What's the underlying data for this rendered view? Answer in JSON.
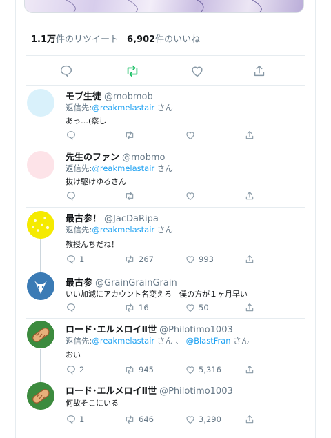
{
  "stats": {
    "retweets_count": "1.1万",
    "retweets_label": "件のリツイート",
    "likes_count": "6,902",
    "likes_label": "件のいいね"
  },
  "colors": {
    "accent": "#1da1f2",
    "retweet_active": "#17bf63",
    "muted": "#657786",
    "line": "#e6ecf0"
  },
  "reply_prefix": "返信先:",
  "san": "さん",
  "tweets": [
    {
      "name": "モブ生徒",
      "handle": "@mobmob",
      "reply_to": [
        "@reakmelastair"
      ],
      "text": "あっ…(察し",
      "replies": "",
      "retweets": "",
      "likes": "",
      "avatar": "light-blue-circle"
    },
    {
      "name": "先生のファン",
      "handle": "@mobmo",
      "reply_to": [
        "@reakmelastair"
      ],
      "text": "抜け駆けゆるさん",
      "replies": "",
      "retweets": "",
      "likes": "",
      "avatar": "pink-circle"
    },
    {
      "name": "最古参！",
      "handle": "@JacDaRipa",
      "reply_to": [
        "@reakmelastair"
      ],
      "text": "教授んちだね！",
      "replies": "1",
      "retweets": "267",
      "likes": "993",
      "avatar": "yellow-circle"
    },
    {
      "name": "最古参",
      "handle": "@GrainGrainGrain",
      "reply_to": [],
      "text": "いい加減にアカウント名変えろ　僕の方が１ヶ月早い",
      "replies": "",
      "retweets": "16",
      "likes": "50",
      "avatar": "blue-fox"
    },
    {
      "name": "ロード･エルメロイⅡ世",
      "handle": "@Philotimo1003",
      "reply_to": [
        "@reakmelastair",
        "@BlastFran"
      ],
      "sep": "、",
      "text": "おい",
      "replies": "2",
      "retweets": "945",
      "likes": "5,316",
      "avatar": "bread-green"
    },
    {
      "name": "ロード･エルメロイⅡ世",
      "handle": "@Philotimo1003",
      "reply_to": [],
      "text": "何故そこにいる",
      "replies": "1",
      "retweets": "646",
      "likes": "3,290",
      "avatar": "bread-green"
    }
  ]
}
